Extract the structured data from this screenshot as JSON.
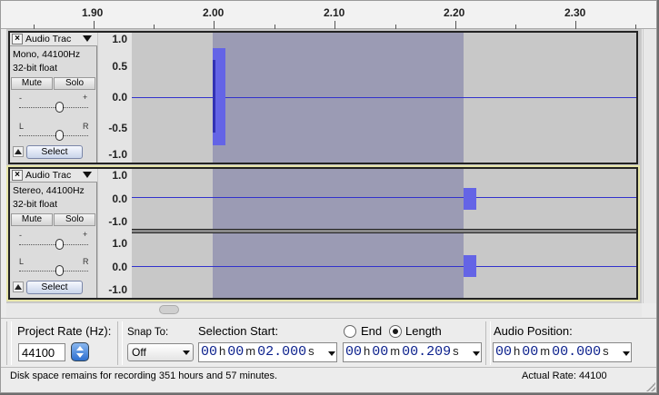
{
  "ruler": {
    "ticks": [
      "1.90",
      "2.00",
      "2.10",
      "2.20",
      "2.30"
    ]
  },
  "tracks": [
    {
      "name": "Audio Trac",
      "close_glyph": "×",
      "info_line1": "Mono, 44100Hz",
      "info_line2": "32-bit float",
      "mute_label": "Mute",
      "solo_label": "Solo",
      "gain_min": "-",
      "gain_max": "+",
      "pan_left": "L",
      "pan_right": "R",
      "select_label": "Select",
      "scale": [
        "1.0",
        "0.5",
        "0.0",
        "-0.5",
        "-1.0"
      ]
    },
    {
      "name": "Audio Trac",
      "close_glyph": "×",
      "info_line1": "Stereo, 44100Hz",
      "info_line2": "32-bit float",
      "mute_label": "Mute",
      "solo_label": "Solo",
      "gain_min": "-",
      "gain_max": "+",
      "pan_left": "L",
      "pan_right": "R",
      "select_label": "Select",
      "scale_left": [
        "1.0",
        "0.0",
        "-1.0"
      ],
      "scale_right": [
        "1.0",
        "0.0",
        "-1.0"
      ]
    }
  ],
  "toolbar": {
    "project_rate_label": "Project Rate (Hz):",
    "project_rate_value": "44100",
    "snap_label": "Snap To:",
    "snap_value": "Off",
    "selection_start_label": "Selection Start:",
    "end_label": "End",
    "length_label": "Length",
    "length_selected": true,
    "audio_position_label": "Audio Position:",
    "selection_start": {
      "h": "00",
      "m": "00",
      "s": "02.000"
    },
    "length": {
      "h": "00",
      "m": "00",
      "s": "00.209"
    },
    "audio_position": {
      "h": "00",
      "m": "00",
      "s": "00.000"
    },
    "unit_h": "h",
    "unit_m": "m",
    "unit_s": "s"
  },
  "status": {
    "message": "Disk space remains for recording 351 hours and 57 minutes.",
    "actual_rate": "Actual Rate: 44100"
  },
  "colors": {
    "waveform": "#3232cc",
    "waveform_peak": "#6464e6",
    "selection": "#9b9bb4",
    "background": "#c8c8c8",
    "time_digits": "#0a1f8c"
  }
}
